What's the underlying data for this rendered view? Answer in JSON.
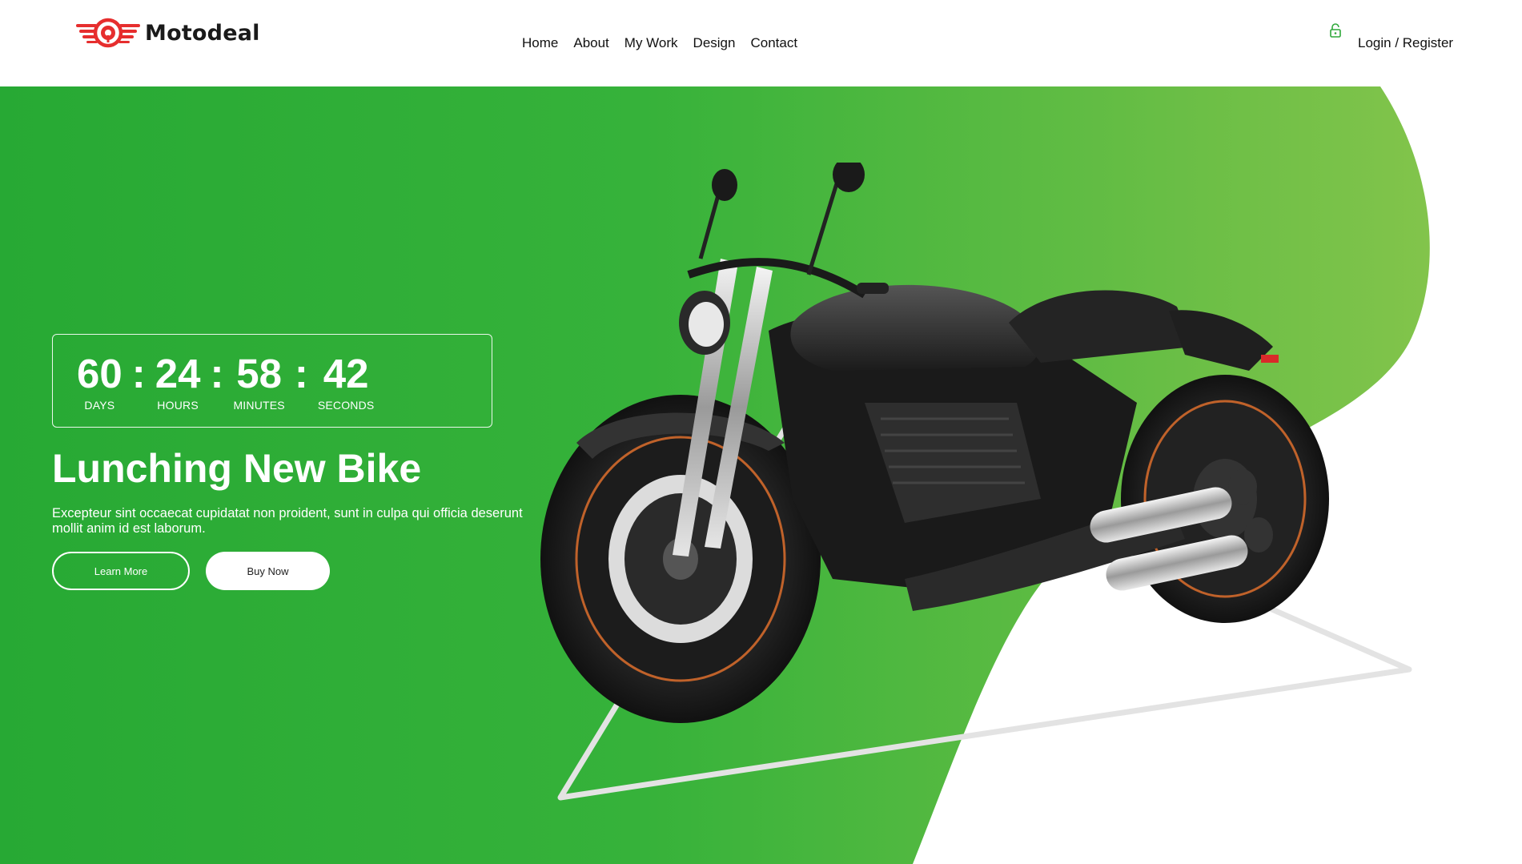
{
  "brand": {
    "name": "Motodeal",
    "accent": "#e62e2e"
  },
  "nav": {
    "items": [
      {
        "label": "Home"
      },
      {
        "label": "About"
      },
      {
        "label": "My Work"
      },
      {
        "label": "Design"
      },
      {
        "label": "Contact"
      }
    ]
  },
  "auth": {
    "label": "Login / Register",
    "icon": "lock-icon",
    "icon_color": "#2ea83a"
  },
  "hero": {
    "countdown": {
      "days": "60",
      "hours": "24",
      "minutes": "58",
      "seconds": "42",
      "separator": ":",
      "labels": {
        "days": "DAYS",
        "hours": "HOURS",
        "minutes": "MINUTES",
        "seconds": "SECONDS"
      }
    },
    "title": "Lunching New Bike",
    "description": "Excepteur sint occaecat cupidatat non proident, sunt in culpa qui officia deserunt mollit anim id est laborum.",
    "buttons": {
      "learn_more": "Learn More",
      "buy_now": "Buy Now"
    },
    "colors": {
      "green_dark": "#26a835",
      "green_light": "#7cc04a"
    },
    "image": "motorcycle"
  }
}
